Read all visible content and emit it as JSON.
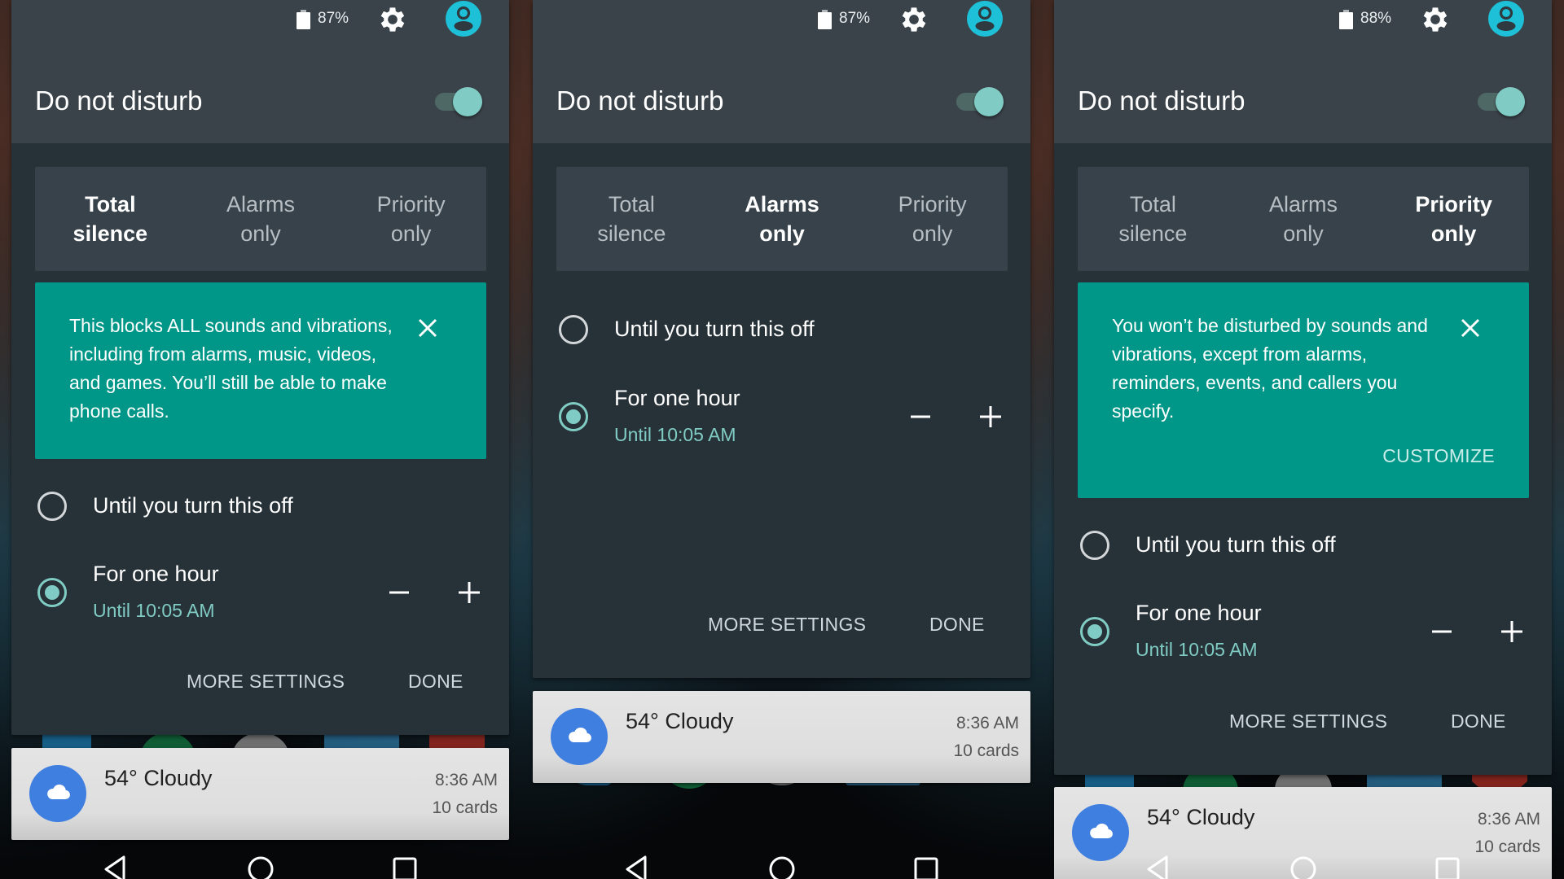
{
  "screens": [
    {
      "status": {
        "battery_pct": "87%",
        "settings_icon": "gear-icon",
        "account_icon": "account-circle-icon"
      },
      "title": "Do not disturb",
      "toggle_on": true,
      "tabs": [
        {
          "label": "Total\nsilence",
          "active": true
        },
        {
          "label": "Alarms\nonly",
          "active": false
        },
        {
          "label": "Priority\nonly",
          "active": false
        }
      ],
      "info_card": {
        "text": "This blocks ALL sounds and vibrations, including from alarms, music, videos, and games. You’ll still be able to make phone calls.",
        "close_icon": "close-icon"
      },
      "options": [
        {
          "label": "Until you turn this off",
          "selected": false
        },
        {
          "label": "For one hour",
          "sublabel": "Until 10:05 AM",
          "selected": true,
          "decrease": "minus-icon",
          "increase": "plus-icon"
        }
      ],
      "buttons": {
        "more_settings": "MORE SETTINGS",
        "done": "DONE"
      },
      "notification": {
        "title": "54° Cloudy",
        "time": "8:36 AM",
        "count": "10 cards",
        "icon": "cloud-icon"
      }
    },
    {
      "status": {
        "battery_pct": "87%",
        "settings_icon": "gear-icon",
        "account_icon": "account-circle-icon"
      },
      "title": "Do not disturb",
      "toggle_on": true,
      "tabs": [
        {
          "label": "Total\nsilence",
          "active": false
        },
        {
          "label": "Alarms\nonly",
          "active": true
        },
        {
          "label": "Priority\nonly",
          "active": false
        }
      ],
      "options": [
        {
          "label": "Until you turn this off",
          "selected": false
        },
        {
          "label": "For one hour",
          "sublabel": "Until 10:05 AM",
          "selected": true,
          "decrease": "minus-icon",
          "increase": "plus-icon"
        }
      ],
      "buttons": {
        "more_settings": "MORE SETTINGS",
        "done": "DONE"
      },
      "notification": {
        "title": "54° Cloudy",
        "time": "8:36 AM",
        "count": "10 cards",
        "icon": "cloud-icon"
      }
    },
    {
      "status": {
        "battery_pct": "88%",
        "settings_icon": "gear-icon",
        "account_icon": "account-circle-icon"
      },
      "title": "Do not disturb",
      "toggle_on": true,
      "tabs": [
        {
          "label": "Total\nsilence",
          "active": false
        },
        {
          "label": "Alarms\nonly",
          "active": false
        },
        {
          "label": "Priority\nonly",
          "active": true
        }
      ],
      "info_card": {
        "text": "You won’t be disturbed by sounds and vibrations, except from alarms, reminders, events, and callers you specify.",
        "close_icon": "close-icon",
        "action": "CUSTOMIZE"
      },
      "options": [
        {
          "label": "Until you turn this off",
          "selected": false
        },
        {
          "label": "For one hour",
          "sublabel": "Until 10:05 AM",
          "selected": true,
          "decrease": "minus-icon",
          "increase": "plus-icon"
        }
      ],
      "buttons": {
        "more_settings": "MORE SETTINGS",
        "done": "DONE"
      },
      "notification": {
        "title": "54° Cloudy",
        "time": "8:36 AM",
        "count": "10 cards",
        "icon": "cloud-icon"
      }
    }
  ],
  "nav_bar": {
    "back": "back-icon",
    "home": "home-icon",
    "recents": "recents-icon"
  },
  "colors": {
    "accent": "#80cbc4",
    "info_card": "#009688",
    "avatar": "#1ec0d8",
    "panel": "#263238",
    "header": "#3a4349"
  }
}
